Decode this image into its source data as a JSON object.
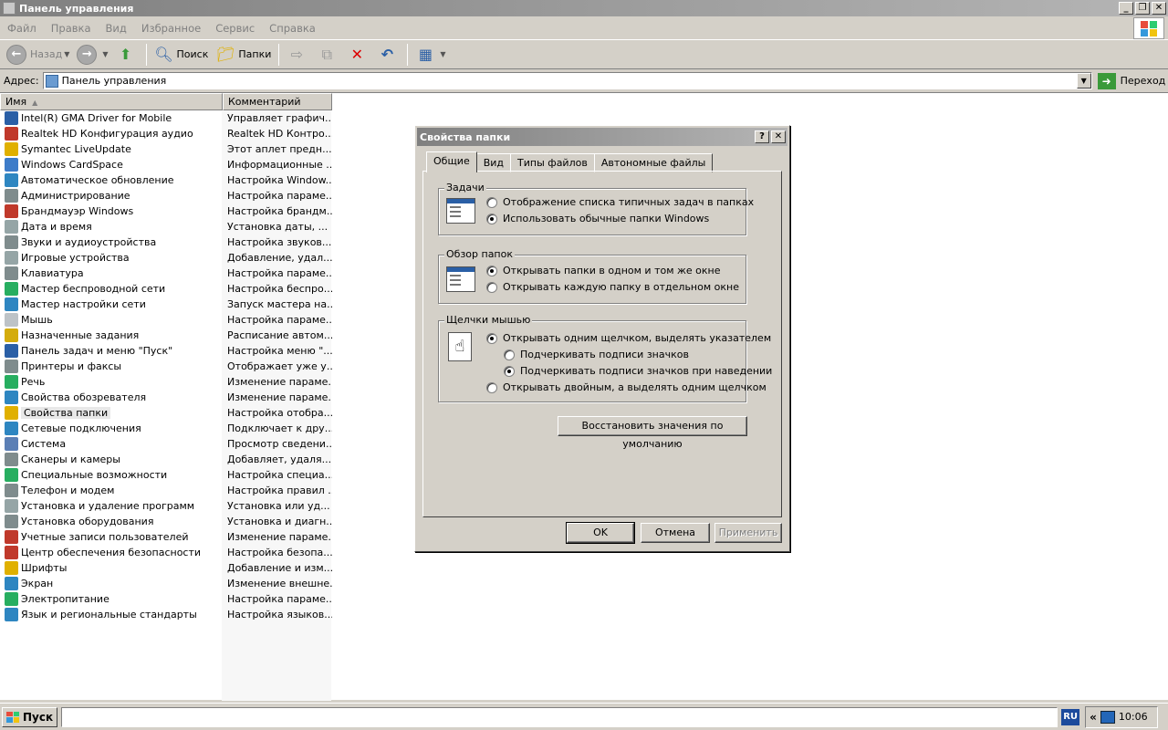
{
  "window": {
    "title": "Панель управления"
  },
  "menu": [
    "Файл",
    "Правка",
    "Вид",
    "Избранное",
    "Сервис",
    "Справка"
  ],
  "toolbar": {
    "back": "Назад",
    "search": "Поиск",
    "folders": "Папки"
  },
  "address": {
    "label": "Адрес:",
    "value": "Панель управления",
    "go": "Переход"
  },
  "columns": {
    "name": "Имя",
    "comment": "Комментарий"
  },
  "items": [
    {
      "name": "Intel(R) GMA Driver for Mobile",
      "comment": "Управляет графич...",
      "color": "#2a5fa6"
    },
    {
      "name": "Realtek HD Конфигурация аудио",
      "comment": "Realtek HD Контро...",
      "color": "#c0392b"
    },
    {
      "name": "Symantec LiveUpdate",
      "comment": "Этот аплет предн...",
      "color": "#e0b000"
    },
    {
      "name": "Windows CardSpace",
      "comment": "Информационные ...",
      "color": "#3d7cc9"
    },
    {
      "name": "Автоматическое обновление",
      "comment": "Настройка Window...",
      "color": "#2e86c1"
    },
    {
      "name": "Администрирование",
      "comment": "Настройка параме...",
      "color": "#7f8c8d"
    },
    {
      "name": "Брандмауэр Windows",
      "comment": "Настройка брандм...",
      "color": "#c0392b"
    },
    {
      "name": "Дата и время",
      "comment": "Установка даты, ...",
      "color": "#95a5a6"
    },
    {
      "name": "Звуки и аудиоустройства",
      "comment": "Настройка звуков...",
      "color": "#7f8c8d"
    },
    {
      "name": "Игровые устройства",
      "comment": "Добавление, удал...",
      "color": "#95a5a6"
    },
    {
      "name": "Клавиатура",
      "comment": "Настройка параме...",
      "color": "#7f8c8d"
    },
    {
      "name": "Мастер беспроводной сети",
      "comment": "Настройка беспро...",
      "color": "#27ae60"
    },
    {
      "name": "Мастер настройки сети",
      "comment": "Запуск мастера на...",
      "color": "#2e86c1"
    },
    {
      "name": "Мышь",
      "comment": "Настройка параме...",
      "color": "#bdc3c7"
    },
    {
      "name": "Назначенные задания",
      "comment": "Расписание автом...",
      "color": "#d4ac0d"
    },
    {
      "name": "Панель задач и меню \"Пуск\"",
      "comment": "Настройка меню \"...",
      "color": "#2a5fa6"
    },
    {
      "name": "Принтеры и факсы",
      "comment": "Отображает уже у...",
      "color": "#7f8c8d"
    },
    {
      "name": "Речь",
      "comment": "Изменение параме...",
      "color": "#27ae60"
    },
    {
      "name": "Свойства обозревателя",
      "comment": "Изменение параме...",
      "color": "#2e86c1"
    },
    {
      "name": "Свойства папки",
      "comment": "Настройка отобра...",
      "color": "#e0b000",
      "selected": true
    },
    {
      "name": "Сетевые подключения",
      "comment": "Подключает к дру...",
      "color": "#2e86c1"
    },
    {
      "name": "Система",
      "comment": "Просмотр сведени...",
      "color": "#5b7fb5"
    },
    {
      "name": "Сканеры и камеры",
      "comment": "Добавляет, удаля...",
      "color": "#7f8c8d"
    },
    {
      "name": "Специальные возможности",
      "comment": "Настройка специа...",
      "color": "#27ae60"
    },
    {
      "name": "Телефон и модем",
      "comment": "Настройка правил ...",
      "color": "#7f8c8d"
    },
    {
      "name": "Установка и удаление программ",
      "comment": "Установка или уд...",
      "color": "#95a5a6"
    },
    {
      "name": "Установка оборудования",
      "comment": "Установка и диагн...",
      "color": "#7f8c8d"
    },
    {
      "name": "Учетные записи пользователей",
      "comment": "Изменение параме...",
      "color": "#c0392b"
    },
    {
      "name": "Центр обеспечения безопасности",
      "comment": "Настройка безопа...",
      "color": "#c0392b"
    },
    {
      "name": "Шрифты",
      "comment": "Добавление и изм...",
      "color": "#e0b000"
    },
    {
      "name": "Экран",
      "comment": "Изменение внешне...",
      "color": "#2e86c1"
    },
    {
      "name": "Электропитание",
      "comment": "Настройка параме...",
      "color": "#27ae60"
    },
    {
      "name": "Язык и региональные стандарты",
      "comment": "Настройка языков...",
      "color": "#2e86c1"
    }
  ],
  "dialog": {
    "title": "Свойства папки",
    "tabs": [
      "Общие",
      "Вид",
      "Типы файлов",
      "Автономные файлы"
    ],
    "tasks": {
      "label": "Задачи",
      "opt1": "Отображение списка типичных задач в папках",
      "opt2": "Использовать обычные папки Windows"
    },
    "browse": {
      "label": "Обзор папок",
      "opt1": "Открывать папки в одном и том же окне",
      "opt2": "Открывать каждую папку в отдельном окне"
    },
    "clicks": {
      "label": "Щелчки мышью",
      "opt1": "Открывать одним щелчком, выделять указателем",
      "opt1a": "Подчеркивать подписи значков",
      "opt1b": "Подчеркивать подписи значков при наведении",
      "opt2": "Открывать двойным, а выделять одним щелчком"
    },
    "restore": "Восстановить значения по умолчанию",
    "ok": "OK",
    "cancel": "Отмена",
    "apply": "Применить"
  },
  "taskbar": {
    "start": "Пуск",
    "lang": "RU",
    "clock": "10:06"
  }
}
